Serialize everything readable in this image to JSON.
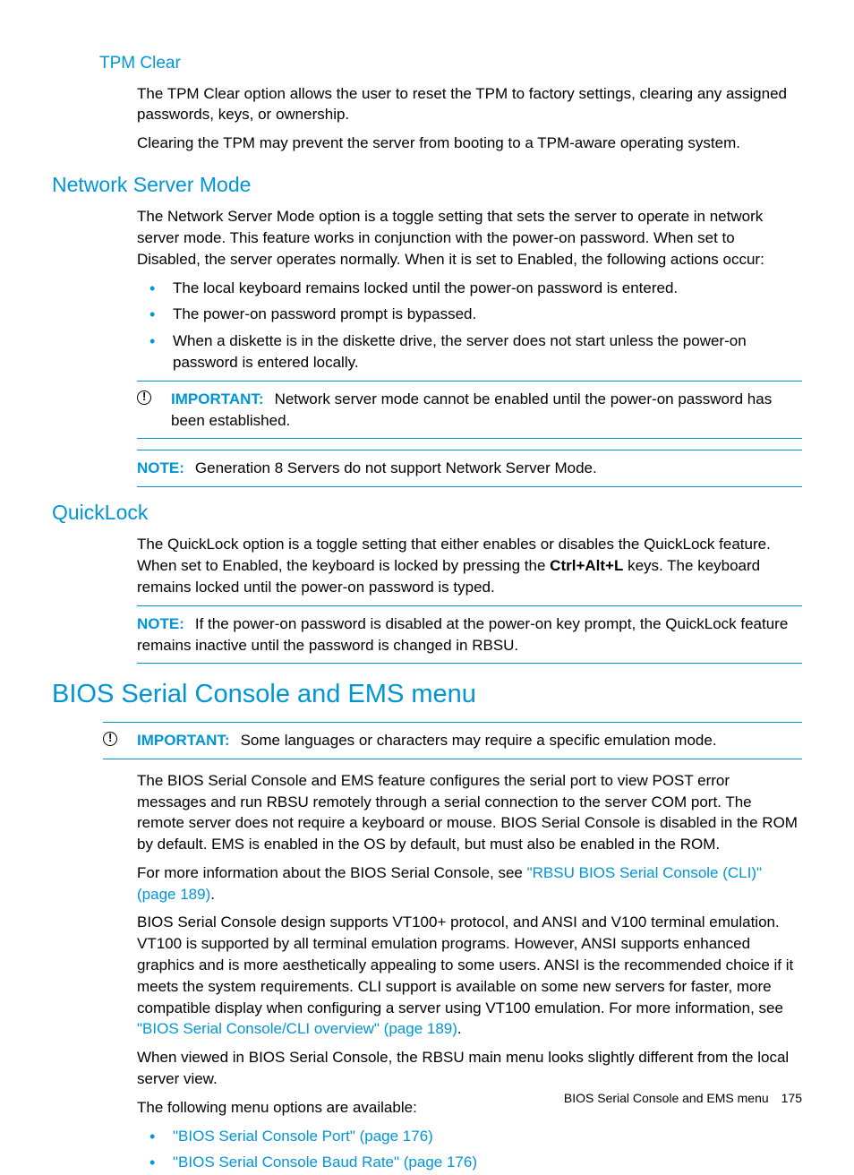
{
  "sections": {
    "tpm": {
      "title": "TPM Clear",
      "p1": "The TPM Clear option allows the user to reset the TPM to factory settings, clearing any assigned passwords, keys, or ownership.",
      "p2": "Clearing the TPM may prevent the server from booting to a TPM-aware operating system."
    },
    "nsm": {
      "title": "Network Server Mode",
      "p1": "The Network Server Mode option is a toggle setting that sets the server to operate in network server mode. This feature works in conjunction with the power-on password. When set to Disabled, the server operates normally. When it is set to Enabled, the following actions occur:",
      "b1": "The local keyboard remains locked until the power-on password is entered.",
      "b2": "The power-on password prompt is bypassed.",
      "b3": "When a diskette is in the diskette drive, the server does not start unless the power-on password is entered locally.",
      "imp_label": "IMPORTANT:",
      "imp_text": "Network server mode cannot be enabled until the power-on password has been established.",
      "note_label": "NOTE:",
      "note_text": "Generation 8 Servers do not support Network Server Mode."
    },
    "ql": {
      "title": "QuickLock",
      "p1a": "The QuickLock option is a toggle setting that either enables or disables the QuickLock feature. When set to Enabled, the keyboard is locked by pressing the ",
      "p1b": "Ctrl+Alt+L",
      "p1c": " keys. The keyboard remains locked until the power-on password is typed.",
      "note_label": "NOTE:",
      "note_text": "If the power-on password is disabled at the power-on key prompt, the QuickLock feature remains inactive until the password is changed in RBSU."
    },
    "bios": {
      "title": "BIOS Serial Console and EMS menu",
      "imp_label": "IMPORTANT:",
      "imp_text": "Some languages or characters may require a specific emulation mode.",
      "p1": "The BIOS Serial Console and EMS feature configures the serial port to view POST error messages and run RBSU remotely through a serial connection to the server COM port. The remote server does not require a keyboard or mouse. BIOS Serial Console is disabled in the ROM by default. EMS is enabled in the OS by default, but must also be enabled in the ROM.",
      "p2a": "For more information about the BIOS Serial Console, see ",
      "p2link": "\"RBSU BIOS Serial Console (CLI)\" (page 189)",
      "p2c": ".",
      "p3a": "BIOS Serial Console design supports VT100+ protocol, and ANSI and V100 terminal emulation. VT100 is supported by all terminal emulation programs. However, ANSI supports enhanced graphics and is more aesthetically appealing to some users. ANSI is the recommended choice if it meets the system requirements. CLI support is available on some new servers for faster, more compatible display when configuring a server using VT100 emulation. For more information, see ",
      "p3link": "\"BIOS Serial Console/CLI overview\" (page 189)",
      "p3c": ".",
      "p4": "When viewed in BIOS Serial Console, the RBSU main menu looks slightly different from the local server view.",
      "p5": "The following menu options are available:",
      "b1": "\"BIOS Serial Console Port\" (page 176)",
      "b2": "\"BIOS Serial Console Baud Rate\" (page 176)"
    }
  },
  "footer": {
    "text": "BIOS Serial Console and EMS menu",
    "page": "175"
  }
}
